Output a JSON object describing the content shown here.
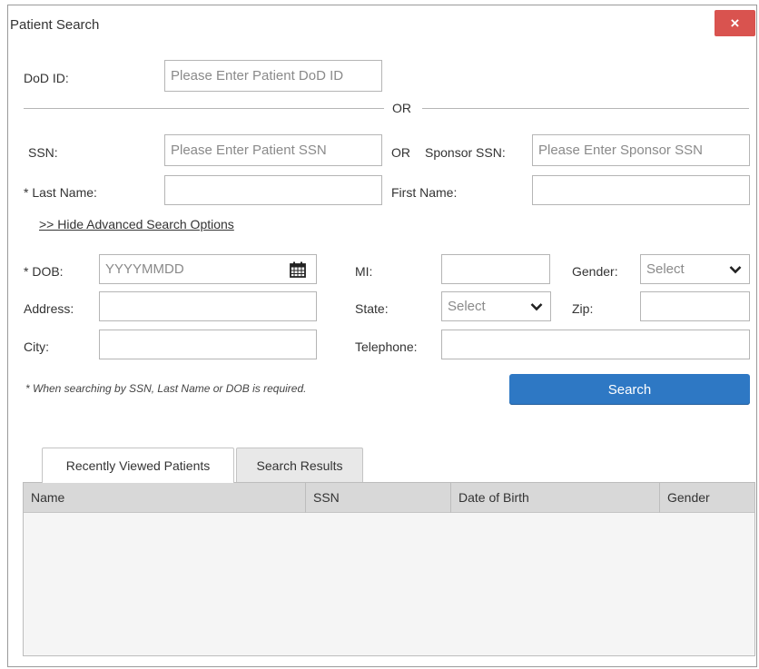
{
  "dialog": {
    "title": "Patient Search",
    "close_label": "×"
  },
  "dod_id": {
    "label": "DoD ID:",
    "placeholder": "Please Enter Patient DoD ID",
    "value": ""
  },
  "or_divider": "OR",
  "ssn": {
    "label": "SSN:",
    "placeholder": "Please Enter Patient SSN",
    "value": ""
  },
  "or_inline": "OR",
  "sponsor_ssn": {
    "label": "Sponsor SSN:",
    "placeholder": "Please Enter Sponsor SSN",
    "value": ""
  },
  "last_name": {
    "label": "* Last Name:",
    "value": ""
  },
  "first_name": {
    "label": "First Name:",
    "value": ""
  },
  "advanced_link": ">> Hide Advanced Search Options",
  "dob": {
    "label": "* DOB:",
    "placeholder": "YYYYMMDD",
    "value": "",
    "icon": "calendar-icon"
  },
  "mi": {
    "label": "MI:",
    "value": ""
  },
  "gender": {
    "label": "Gender:",
    "selected": "Select",
    "icon": "chevron-down-icon"
  },
  "address": {
    "label": "Address:",
    "value": ""
  },
  "state": {
    "label": "State:",
    "selected": "Select",
    "icon": "chevron-down-icon"
  },
  "zip": {
    "label": "Zip:",
    "value": ""
  },
  "city": {
    "label": "City:",
    "value": ""
  },
  "telephone": {
    "label": "Telephone:",
    "value": ""
  },
  "note": "* When searching by SSN, Last Name or DOB is required.",
  "search_button": "Search",
  "tabs": [
    {
      "label": "Recently Viewed Patients",
      "active": true
    },
    {
      "label": "Search Results",
      "active": false
    }
  ],
  "table": {
    "columns": [
      "Name",
      "SSN",
      "Date of Birth",
      "Gender"
    ],
    "rows": []
  },
  "colors": {
    "close_button": "#d9534f",
    "search_button": "#2e78c4",
    "table_header": "#d8d8d8"
  }
}
